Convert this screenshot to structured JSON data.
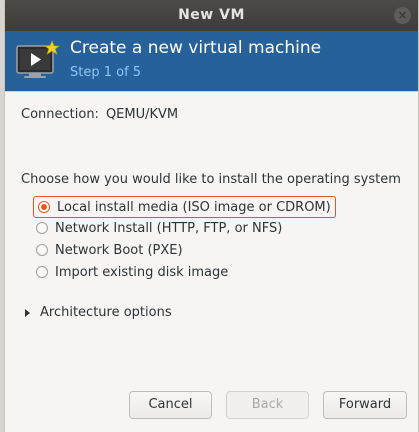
{
  "window": {
    "title": "New VM",
    "close_glyph": "×"
  },
  "header": {
    "title": "Create a new virtual machine",
    "step": "Step 1 of 5",
    "icon": "vm-wizard-icon",
    "colors": {
      "background": "#26619a",
      "step_text": "#8ec6f5"
    }
  },
  "connection": {
    "label": "Connection:",
    "value": "QEMU/KVM"
  },
  "install": {
    "prompt": "Choose how you would like to install the operating system",
    "options": [
      {
        "label": "Local install media (ISO image or CDROM)",
        "selected": true
      },
      {
        "label": "Network Install (HTTP, FTP, or NFS)",
        "selected": false
      },
      {
        "label": "Network Boot (PXE)",
        "selected": false
      },
      {
        "label": "Import existing disk image",
        "selected": false
      }
    ]
  },
  "architecture": {
    "label": "Architecture options",
    "expanded": false
  },
  "buttons": {
    "cancel": "Cancel",
    "back": "Back",
    "forward": "Forward"
  },
  "accent_color": "#e95420"
}
